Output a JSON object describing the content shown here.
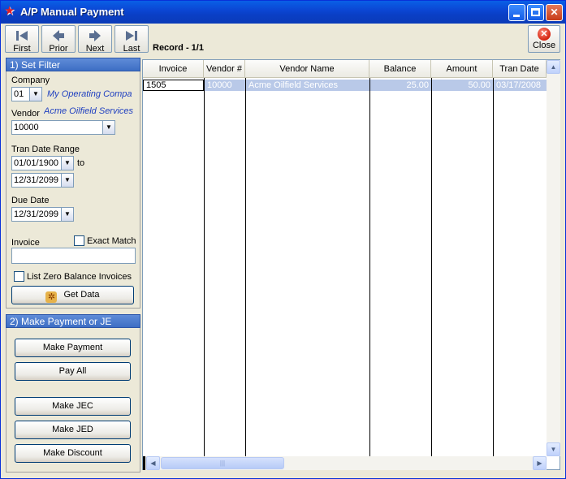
{
  "window": {
    "title": "A/P Manual Payment"
  },
  "toolbar": {
    "first": "First",
    "prior": "Prior",
    "next": "Next",
    "last": "Last",
    "record": "Record - 1/1",
    "close": "Close"
  },
  "filter": {
    "header": "1)  Set Filter",
    "company_label": "Company",
    "company_value": "01",
    "company_name": "My Operating Compa",
    "vendor_label": "Vendor",
    "vendor_name": "Acme Oilfield Services",
    "vendor_value": "10000",
    "tran_range_label": "Tran Date Range",
    "tran_from": "01/01/1900",
    "to_label": "to",
    "tran_to": "12/31/2099",
    "due_label": "Due Date",
    "due_value": "12/31/2099",
    "invoice_label": "Invoice",
    "invoice_value": "",
    "exact_match_label": "Exact Match",
    "zero_balance_label": "List Zero Balance Invoices",
    "get_data_label": "Get Data"
  },
  "actions": {
    "header": "2) Make Payment or JE",
    "make_payment": "Make Payment",
    "pay_all": "Pay All",
    "make_jec": "Make JEC",
    "make_jed": "Make JED",
    "make_discount": "Make Discount"
  },
  "grid": {
    "columns": [
      "Invoice",
      "Vendor #",
      "Vendor Name",
      "Balance",
      "Amount",
      "Tran Date"
    ],
    "rows": [
      {
        "invoice": "1505",
        "vendor_no": "10000",
        "vendor_name": "Acme Oilfield Services",
        "balance": "25.00",
        "amount": "50.00",
        "tran_date": "03/17/2008"
      }
    ]
  }
}
